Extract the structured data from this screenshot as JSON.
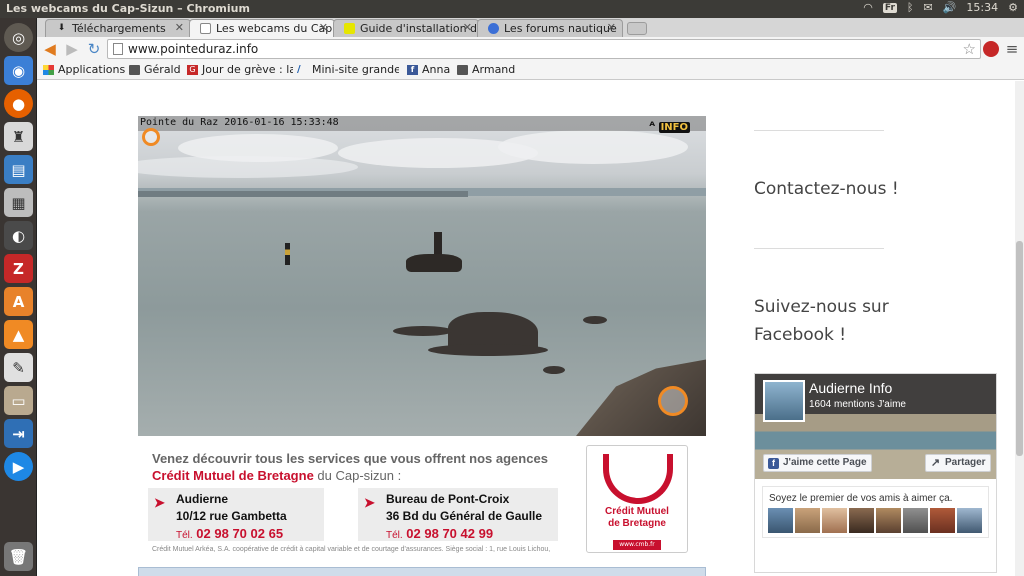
{
  "os_panel": {
    "window_title": "Les webcams du Cap-Sizun – Chromium",
    "keyboard_layout": "Fr",
    "clock": "15:34"
  },
  "launcher": {
    "items": [
      "ubuntu-dash",
      "chromium",
      "firefox",
      "system-monitor",
      "writer",
      "calculator",
      "webcam-app",
      "filezilla",
      "software-center",
      "vlc",
      "inkscape",
      "file-manager",
      "virtualbox",
      "media-player",
      "trash"
    ]
  },
  "browser": {
    "tabs": [
      {
        "label": "Téléchargements",
        "favicon": "download-icon",
        "active": false
      },
      {
        "label": "Les webcams du Cap",
        "favicon": "page-icon",
        "active": true
      },
      {
        "label": "Guide d'installation d",
        "favicon": "yellow-square-icon",
        "active": false
      },
      {
        "label": "Les forums nautique",
        "favicon": "globe-icon",
        "active": false
      }
    ],
    "url": "www.pointeduraz.info",
    "bookmarks": [
      {
        "label": "Applications",
        "icon": "apps-grid-icon"
      },
      {
        "label": "Gérald",
        "icon": "folder-icon"
      },
      {
        "label": "Jour de grève : la",
        "icon": "g-icon"
      },
      {
        "label": "Mini-site grande c",
        "icon": "v-icon"
      },
      {
        "label": "Anna",
        "icon": "facebook-icon"
      },
      {
        "label": "Armand",
        "icon": "folder-icon"
      }
    ]
  },
  "webcam": {
    "stamp": "Pointe du Raz 2016-01-16 15:33:48",
    "logo_text": "INFO"
  },
  "ad": {
    "headline": "Venez découvrir tous les services que vous offrent nos agences",
    "brand": "Crédit Mutuel de Bretagne",
    "headline_suffix": " du Cap-sizun :",
    "agencies": [
      {
        "name": "Audierne",
        "address": "10/12 rue Gambetta",
        "tel_prefix": "Tél.",
        "tel": "02 98 70 02 65"
      },
      {
        "name": "Bureau de Pont-Croix",
        "address": "36 Bd du Général de Gaulle",
        "tel_prefix": "Tél.",
        "tel": "02 98 70 42 99"
      }
    ],
    "legal": "Crédit Mutuel Arkéa, S.A. coopérative de crédit à capital variable et de courtage d'assurances. Siège social : 1, rue Louis Lichou,",
    "logo_name_line1": "Crédit Mutuel",
    "logo_name_line2": "de Bretagne",
    "logo_url": "www.cmb.fr"
  },
  "sidebar": {
    "contact": "Contactez-nous !",
    "facebook_title_line1": "Suivez-nous sur",
    "facebook_title_line2": "Facebook !",
    "fb_widget": {
      "page_name": "Audierne Info",
      "likes": "1604 mentions J'aime",
      "like_button": "J'aime cette Page",
      "share_button": "Partager",
      "friends_text": "Soyez le premier de vos amis à aimer ça."
    }
  },
  "colors": {
    "brand_red": "#c8102e",
    "facebook_blue": "#3b5998",
    "chrome_gray": "#f4f4f4"
  }
}
